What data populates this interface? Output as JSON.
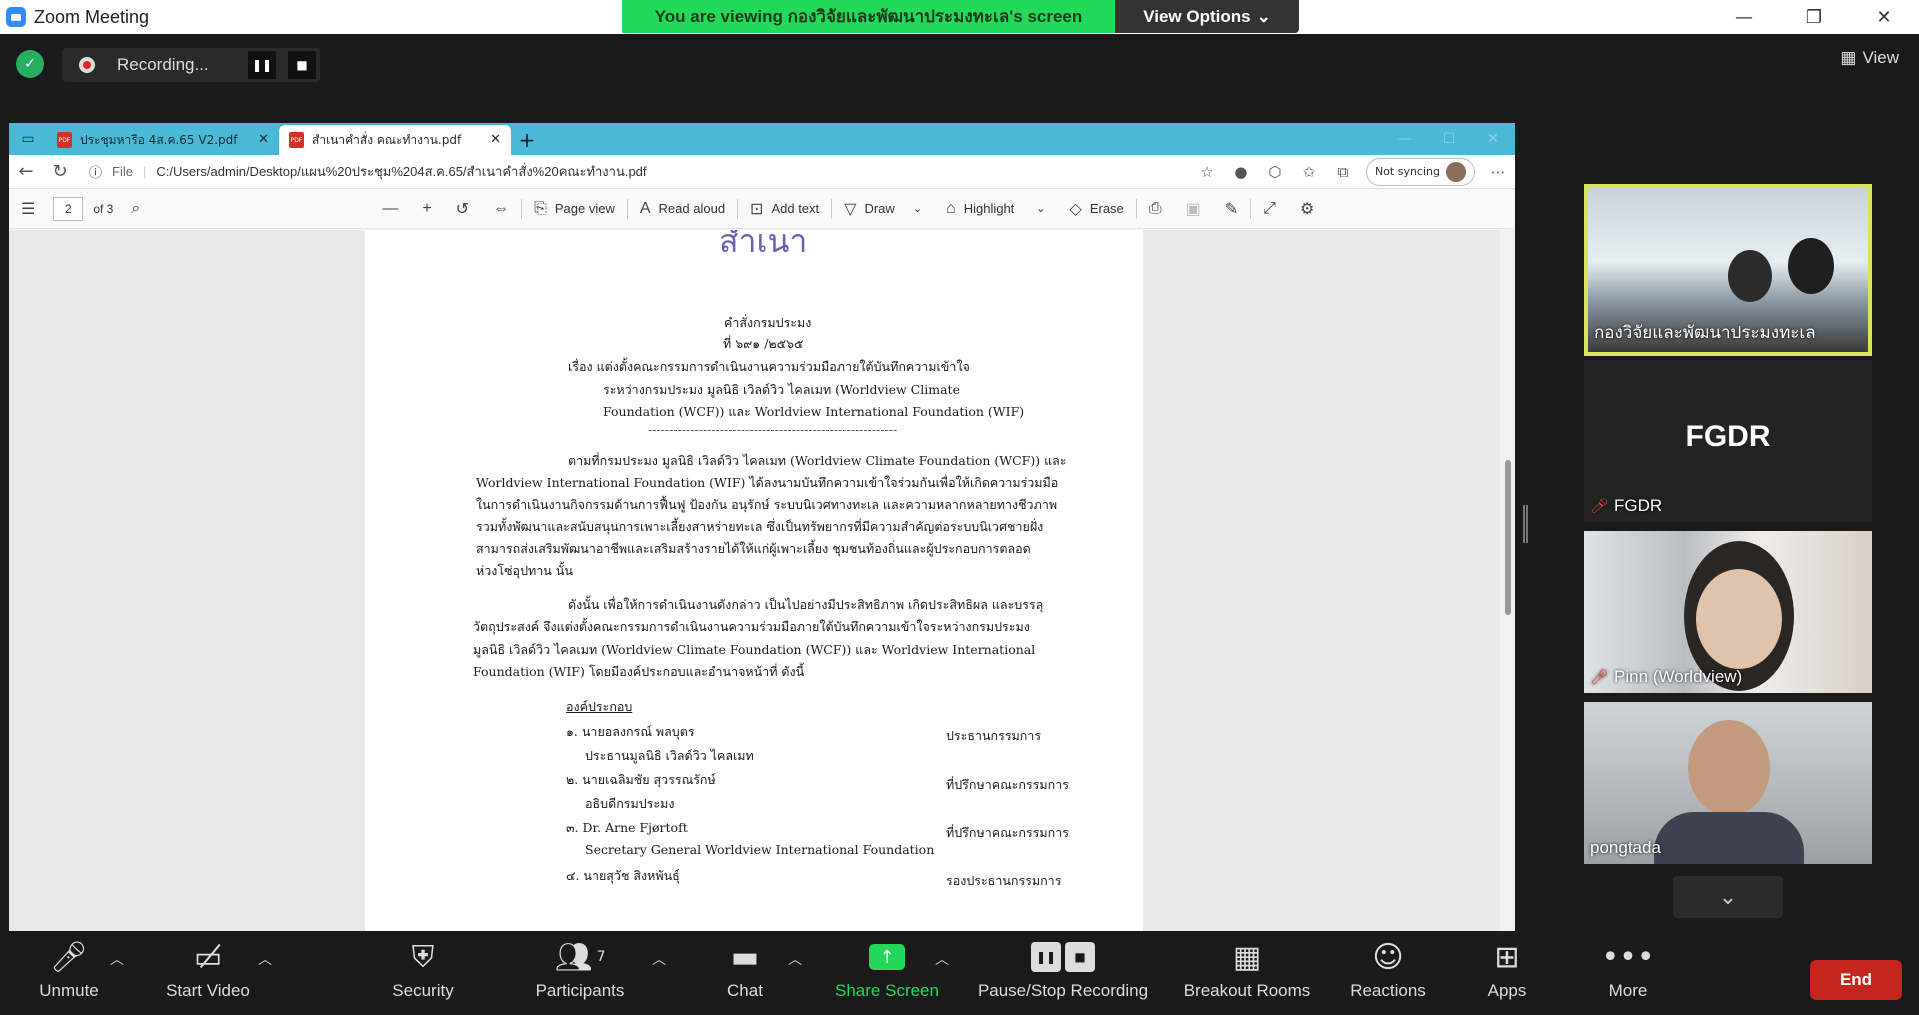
{
  "window": {
    "title": "Zoom Meeting"
  },
  "viewing_bar": {
    "message": "You are viewing กองวิจัยและพัฒนาประมงทะเล's screen",
    "options": "View Options"
  },
  "recording": {
    "label": "Recording..."
  },
  "top_right": {
    "view": "View"
  },
  "browser": {
    "tabs": [
      {
        "label": "ประชุมหารือ 4ส.ค.65 V2.pdf"
      },
      {
        "label": "สำเนาคำสั่ง คณะทำงาน.pdf"
      }
    ],
    "file_label": "File",
    "url": "C:/Users/admin/Desktop/แผน%20ประชุม%204ส.ค.65/สำเนาคำสั่ง%20คณะทำงาน.pdf",
    "sync": "Not syncing"
  },
  "pdf_toolbar": {
    "page": "2",
    "of": "of 3",
    "page_view": "Page view",
    "read_aloud": "Read aloud",
    "add_text": "Add text",
    "draw": "Draw",
    "highlight": "Highlight",
    "erase": "Erase"
  },
  "document": {
    "stamp": "สำเนา",
    "order_title": "คำสั่งกรมประมง",
    "order_no": "ที่ ๖๙๑ /๒๕๖๕",
    "subject_lines": [
      "เรื่อง  แต่งตั้งคณะกรรมการดำเนินงานความร่วมมือภายใต้บันทึกความเข้าใจ",
      "ระหว่างกรมประมง มูลนิธิ เวิลด์วิว ไคลเมท (Worldview Climate",
      "Foundation (WCF)) และ Worldview International Foundation (WIF)"
    ],
    "dashes": "-----------------------------------------------------------",
    "para1": [
      "ตามที่กรมประมง มูลนิธิ เวิลด์วิว ไคลเมท (Worldview Climate Foundation (WCF)) และ",
      "Worldview International Foundation (WIF) ได้ลงนามบันทึกความเข้าใจร่วมกันเพื่อให้เกิดความร่วมมือ",
      "ในการดำเนินงานกิจกรรมด้านการฟื้นฟู ป้องกัน อนุรักษ์ ระบบนิเวศทางทะเล และความหลากหลายทางชีวภาพ",
      "รวมทั้งพัฒนาและสนับสนุนการเพาะเลี้ยงสาหร่ายทะเล ซึ่งเป็นทรัพยากรที่มีความสำคัญต่อระบบนิเวศชายฝั่ง",
      "สามารถส่งเสริมพัฒนาอาชีพและเสริมสร้างรายได้ให้แก่ผู้เพาะเลี้ยง ชุมชนท้องถิ่นและผู้ประกอบการตลอด",
      "ห่วงโซ่อุปทาน นั้น"
    ],
    "para2": [
      "ดังนั้น เพื่อให้การดำเนินงานดังกล่าว เป็นไปอย่างมีประสิทธิภาพ เกิดประสิทธิผล และบรรลุ",
      "วัตถุประสงค์ จึงแต่งตั้งคณะกรรมการดำเนินงานความร่วมมือภายใต้บันทึกความเข้าใจระหว่างกรมประมง",
      "มูลนิธิ เวิลด์วิว ไคลเมท (Worldview Climate Foundation (WCF)) และ Worldview International",
      "Foundation (WIF) โดยมีองค์ประกอบและอำนาจหน้าที่ ดังนี้"
    ],
    "composition": "องค์ประกอบ",
    "members": [
      {
        "name": "๑. นายอลงกรณ์ พลบุตร",
        "title": "ประธานมูลนิธิ เวิลด์วิว ไคลเมท",
        "role": "ประธานกรรมการ"
      },
      {
        "name": "๒. นายเฉลิมชัย สุวรรณรักษ์",
        "title": "อธิบดีกรมประมง",
        "role": "ที่ปรึกษาคณะกรรมการ"
      },
      {
        "name": "๓. Dr. Arne Fjørtoft",
        "title": "Secretary General Worldview International Foundation",
        "role": "ที่ปรึกษาคณะกรรมการ"
      },
      {
        "name": "๔. นายสุวัช สิงหพันธุ์",
        "title": "",
        "role": "รองประธานกรรมการ"
      }
    ]
  },
  "participants": [
    {
      "name": "กองวิจัยและพัฒนาประมงทะเล",
      "muted": false
    },
    {
      "name": "FGDR",
      "muted": true,
      "display": "FGDR"
    },
    {
      "name": "Pinn (Worldview)",
      "muted": true
    },
    {
      "name": "pongtada",
      "muted": false
    }
  ],
  "toolbar": {
    "unmute": "Unmute",
    "start_video": "Start Video",
    "security": "Security",
    "participants": "Participants",
    "participants_count": "7",
    "chat": "Chat",
    "share_screen": "Share Screen",
    "pause_stop": "Pause/Stop Recording",
    "breakout": "Breakout Rooms",
    "reactions": "Reactions",
    "apps": "Apps",
    "more": "More",
    "end": "End"
  }
}
